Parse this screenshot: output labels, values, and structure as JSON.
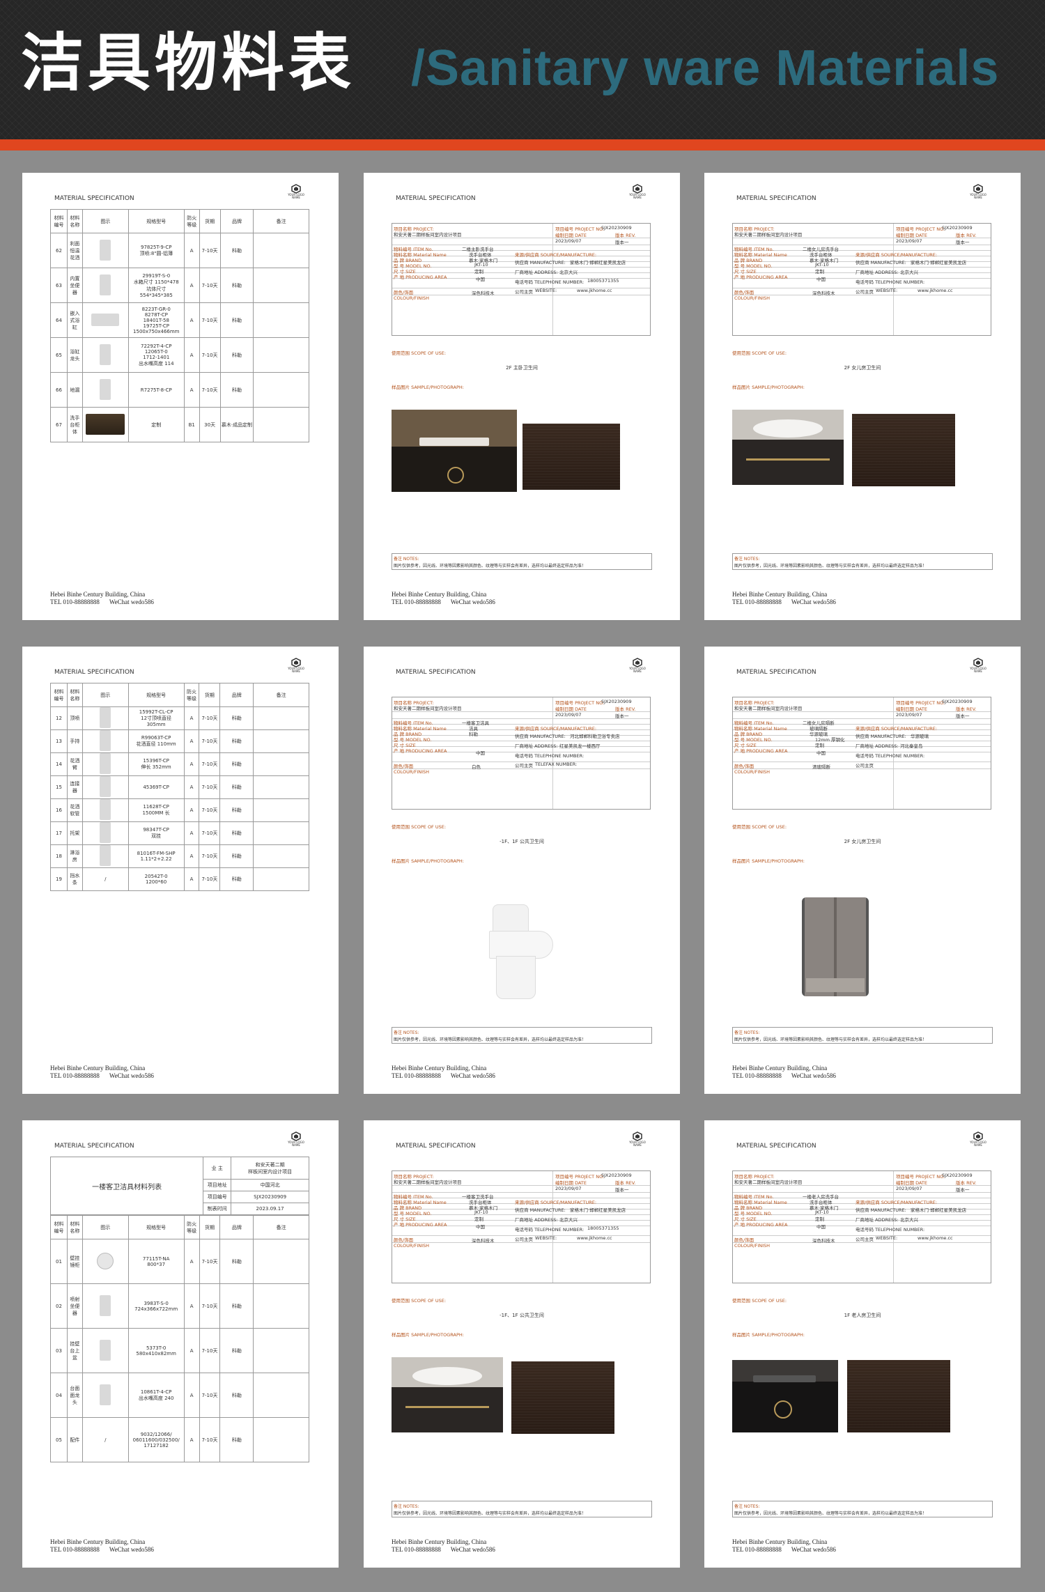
{
  "header": {
    "title_cn": "洁具物料表",
    "title_en": "/Sanitary ware Materials"
  },
  "common": {
    "ms": "MATERIAL SPECIFICATION",
    "logo_text": "YOUR LOGO\nNAME",
    "footer_addr": "Hebei Binhe Century Building, China",
    "footer_tel": "TEL   010-88888888",
    "footer_wechat": "WeChat   wedo586",
    "scope": "使用范围   SCOPE OF USE:",
    "sample": "样品图片   SAMPLE/PHOTOGRAPH:",
    "notes_label": "备注   NOTES:",
    "notes_text": "图片仅供参考，因光线、环境等因素影响其颜色、纹理等与实样会有差异，选样均以最终选定样品为准！"
  },
  "table_headers": [
    "材料编号",
    "材料名称",
    "图示",
    "规格型号",
    "防火等级",
    "货期",
    "品牌",
    "备注"
  ],
  "list_a": {
    "rows": [
      {
        "no": "62",
        "name": "利面恒温花洒",
        "spec": "97825T-9-CP\n顶喷:8\"圆-铝薄",
        "fire": "A",
        "period": "7-10天",
        "brand": "科勒",
        "note": ""
      },
      {
        "no": "63",
        "name": "内置坐便器",
        "spec": "29919T-S-0\n水箱尺寸 1150*478\n坑体尺寸\n554*345*385",
        "fire": "A",
        "period": "7-10天",
        "brand": "科勒",
        "note": ""
      },
      {
        "no": "64",
        "name": "嵌入式浴缸",
        "spec": "8223T-GR-0\n8278T-CP\n18401T-58\n19725T-CP\n1500x750x466mm",
        "fire": "A",
        "period": "7-10天",
        "brand": "科勒",
        "note": ""
      },
      {
        "no": "65",
        "name": "浴缸龙头",
        "spec": "72292T-4-CP\n12065T-0\n1712-1401\n出水嘴高度 114",
        "fire": "A",
        "period": "7-10天",
        "brand": "科勒",
        "note": ""
      },
      {
        "no": "66",
        "name": "地漏",
        "spec": "R7275T-8-CP",
        "fire": "A",
        "period": "7-10天",
        "brand": "科勒",
        "note": ""
      },
      {
        "no": "67",
        "name": "洗手台柜体",
        "spec": "定制",
        "fire": "B1",
        "period": "30天",
        "brand": "慕木·成品定制",
        "note": ""
      }
    ]
  },
  "list_b": {
    "rows": [
      {
        "no": "12",
        "name": "顶喷",
        "spec": "15992T-CL-CP\n12寸顶喷直径\n305mm",
        "fire": "A",
        "period": "7-10天",
        "brand": "科勒",
        "note": ""
      },
      {
        "no": "13",
        "name": "手持",
        "spec": "R99063T-CP\n花洒直径 110mm",
        "fire": "A",
        "period": "7-10天",
        "brand": "科勒",
        "note": ""
      },
      {
        "no": "14",
        "name": "花洒臂",
        "spec": "15396T-CP\n伸长 352mm",
        "fire": "A",
        "period": "7-10天",
        "brand": "科勒",
        "note": ""
      },
      {
        "no": "15",
        "name": "连接器",
        "spec": "45369T-CP",
        "fire": "A",
        "period": "7-10天",
        "brand": "科勒",
        "note": ""
      },
      {
        "no": "16",
        "name": "花洒软管",
        "spec": "11628T-CP\n1500MM 长",
        "fire": "A",
        "period": "7-10天",
        "brand": "科勒",
        "note": ""
      },
      {
        "no": "17",
        "name": "托架",
        "spec": "98347T-CP\n双挂",
        "fire": "A",
        "period": "7-10天",
        "brand": "科勒",
        "note": ""
      },
      {
        "no": "18",
        "name": "淋浴房",
        "spec": "81016T-FM-SHP\n1.11*2+2.22",
        "fire": "A",
        "period": "7-10天",
        "brand": "科勒",
        "note": ""
      },
      {
        "no": "19",
        "name": "挡水条",
        "spec": "20542T-0\n1200*60",
        "fire": "A",
        "period": "7-10天",
        "brand": "科勒",
        "note": "",
        "slash": "/"
      }
    ]
  },
  "list_c": {
    "title": "一楼客卫洁具材料列表",
    "meta": [
      {
        "k": "业 主",
        "v": "和安天著二期\n样板间室内设计项目"
      },
      {
        "k": "项目地址",
        "v": "中国河北"
      },
      {
        "k": "项目编号",
        "v": "SJX20230909"
      },
      {
        "k": "制表时间",
        "v": "2023.09.17"
      }
    ],
    "rows": [
      {
        "no": "01",
        "name": "壁挂镜柜",
        "spec": "77115T-NA\n800*37",
        "fire": "A",
        "period": "7-10天",
        "brand": "科勒",
        "note": ""
      },
      {
        "no": "02",
        "name": "喷射坐便器",
        "spec": "3983T-S-0\n724x366x722mm",
        "fire": "A",
        "period": "7-10天",
        "brand": "科勒",
        "note": ""
      },
      {
        "no": "03",
        "name": "挂壁台上盆",
        "spec": "5373T-0\n580x410x82mm",
        "fire": "A",
        "period": "7-10天",
        "brand": "科勒",
        "note": ""
      },
      {
        "no": "04",
        "name": "台面面龙头",
        "spec": "10861T-4-CP\n出水嘴高度 240",
        "fire": "A",
        "period": "7-10天",
        "brand": "科勒",
        "note": ""
      },
      {
        "no": "05",
        "name": "配件",
        "spec": "9032/12066/\n06011600/032500/\n17127182",
        "fire": "A",
        "period": "7-10天",
        "brand": "科勒",
        "note": "",
        "slash": "/"
      }
    ]
  },
  "specs": [
    {
      "project": "和安天著二期样板间室内设计项目",
      "project_no": "SJX20230909",
      "date": "2023/09/07",
      "rev": "版本一",
      "item_no": "二楼主卧洗手台",
      "material": "洗手台柜体",
      "brand": "慕木·家格木门",
      "model": "JKT-10",
      "size": "定制",
      "area": "中国",
      "colour": "深色科技木",
      "supplier": "家格木门·邯郸红星美凯龙店",
      "address": "北京大兴",
      "tel": "18005371355",
      "web_label": "WEBSITE:",
      "web": "www.jkhome.cc",
      "scope": "2F 主卧卫生间"
    },
    {
      "project": "和安天著二期样板间室内设计项目",
      "project_no": "SJX20230909",
      "date": "2023/09/07",
      "rev": "版本一",
      "item_no": "二楼女儿房洗手台",
      "material": "洗手台柜体",
      "brand": "慕木·家格木门",
      "model": "JKT-10",
      "size": "定制",
      "area": "中国",
      "colour": "深色科技木",
      "supplier": "家格木门·邯郸红星美凯龙店",
      "address": "北京大兴",
      "tel": "",
      "web_label": "WEBSITE:",
      "web": "www.jkhome.cc",
      "scope": "2F 女儿房卫生间"
    },
    {
      "project": "和安天著二期样板间室内设计项目",
      "project_no": "SJX20230909",
      "date": "2023/09/07",
      "rev": "版本一",
      "item_no": "一楼客卫洁具",
      "material": "洁具",
      "brand": "科勒",
      "model": "",
      "size": "",
      "area": "中国",
      "colour": "白色",
      "supplier": "河北邯郸科勒卫浴专卖店",
      "address": "红星美凯龙一楼西厅",
      "tel": "",
      "web_label": "TELEFAX NUMBER:",
      "web": "",
      "scope": "-1F、1F 公共卫生间"
    },
    {
      "project": "和安天著二期样板间室内设计项目",
      "project_no": "SJX20230909",
      "date": "2023/09/07",
      "rev": "版本一",
      "item_no": "二楼女儿房隔断",
      "material": "玻璃隔断",
      "brand": "华源玻璃",
      "model": "12mm 厚钢化",
      "size": "定制",
      "area": "中国",
      "colour": "清玻隔断",
      "supplier": "华源玻璃",
      "address": "河北秦皇岛",
      "tel": "",
      "web_label": "",
      "web": "",
      "scope": "2F 女儿房卫生间"
    },
    {
      "project": "和安天著二期样板间室内设计项目",
      "project_no": "SJX20230909",
      "date": "2023/09/07",
      "rev": "版本一",
      "item_no": "一楼客卫洗手台",
      "material": "洗手台柜体",
      "brand": "慕木·家格木门",
      "model": "JKT-10",
      "size": "定制",
      "area": "中国",
      "colour": "深色科技木",
      "supplier": "家格木门·邯郸红星美凯龙店",
      "address": "北京大兴",
      "tel": "18005371355",
      "web_label": "WEBSITE:",
      "web": "www.jkhome.cc",
      "scope": "-1F、1F 公共卫生间"
    },
    {
      "project": "和安天著二期样板间室内设计项目",
      "project_no": "SJX20230909",
      "date": "2023/09/07",
      "rev": "版本一",
      "item_no": "一楼老人房洗手台",
      "material": "洗手台柜体",
      "brand": "慕木·家格木门",
      "model": "JKT-10",
      "size": "定制",
      "area": "中国",
      "colour": "深色科技木",
      "supplier": "家格木门·邯郸红星美凯龙店",
      "address": "北京大兴",
      "tel": "",
      "web_label": "WEBSITE:",
      "web": "www.jkhome.cc",
      "scope": "1F 老人房卫生间"
    }
  ],
  "info_labels": {
    "project": "项目名称   PROJECT:",
    "project_no": "项目编号   PROJECT NO.",
    "date": "编制日期   DATE",
    "rev": "版本   REV.",
    "item_no": "物料编号   ITEM No.",
    "material": "物料名称   Material Name",
    "brand": "品   牌   BRAND",
    "model": "型   号   MODEL NO.",
    "size": "尺   寸   SIZE",
    "area": "产   地   PRODUCING AREA",
    "colour": "颜色/饰面   COLOUR/FINISH",
    "source": "来源/供应商   SOURCE/MANUFACTURE:",
    "manufacture": "供应商   MANUFACTURE:",
    "address": "厂商地址   ADDRESS:",
    "tel": "电话号码   TELEPHONE NUMBER:",
    "web": "公司主页"
  }
}
